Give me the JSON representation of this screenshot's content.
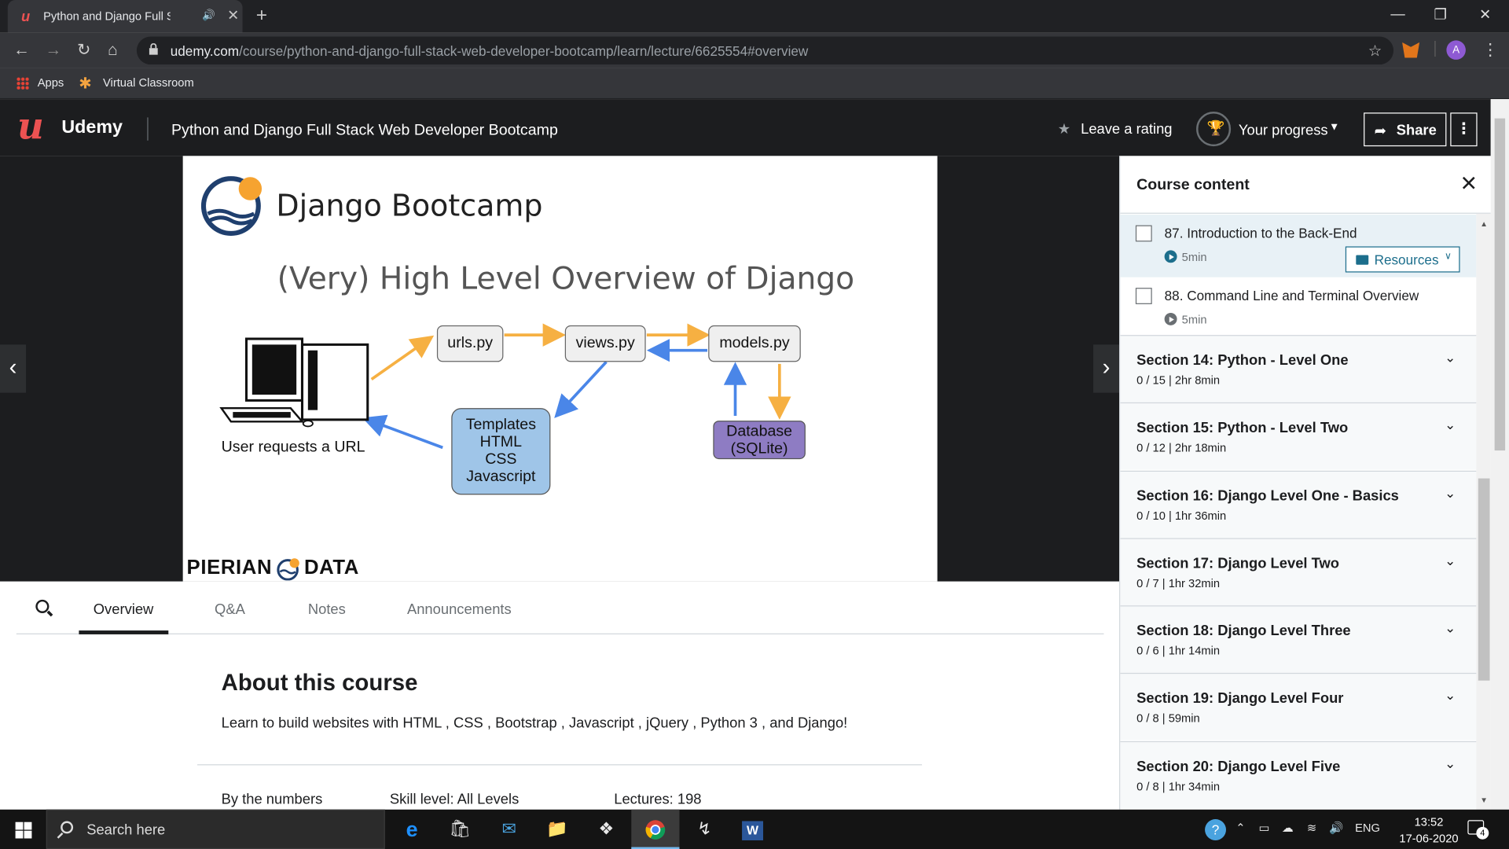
{
  "browser": {
    "tab_title": "Python and Django Full Stack Web Developer Bootcamp",
    "url_domain": "udemy.com",
    "url_path": "/course/python-and-django-full-stack-web-developer-bootcamp/learn/lecture/6625554#overview",
    "bookmarks": [
      "Apps",
      "Virtual Classroom"
    ],
    "profile_initial": "A"
  },
  "header": {
    "logo": "Udemy",
    "course_title": "Python and Django Full Stack Web Developer Bootcamp",
    "rating_label": "Leave a rating",
    "progress_label": "Your progress",
    "share_label": "Share"
  },
  "slide": {
    "brand_title": "Django Bootcamp",
    "heading": "(Very) High Level Overview of Django",
    "user_caption": "User requests a URL",
    "nodes": {
      "urls": "urls.py",
      "views": "views.py",
      "models": "models.py",
      "templates": [
        "Templates",
        "HTML",
        "CSS",
        "Javascript"
      ],
      "database": [
        "Database",
        "(SQLite)"
      ]
    },
    "footer_left": "PIERIAN",
    "footer_right": "DATA"
  },
  "content_tabs": [
    "Overview",
    "Q&A",
    "Notes",
    "Announcements"
  ],
  "about": {
    "title": "About this course",
    "description": "Learn to build websites with HTML , CSS , Bootstrap , Javascript , jQuery , Python 3 , and Django!",
    "stats": [
      "By the numbers",
      "Skill level: All Levels",
      "Lectures: 198"
    ]
  },
  "sidebar": {
    "title": "Course content",
    "lectures": [
      {
        "title": "87. Introduction to the Back-End",
        "duration": "5min",
        "resources": "Resources"
      },
      {
        "title": "88. Command Line and Terminal Overview",
        "duration": "5min"
      }
    ],
    "sections": [
      {
        "title": "Section 14: Python - Level One",
        "meta": "0 / 15 | 2hr 8min"
      },
      {
        "title": "Section 15: Python - Level Two",
        "meta": "0 / 12 | 2hr 18min"
      },
      {
        "title": "Section 16: Django Level One - Basics",
        "meta": "0 / 10 | 1hr 36min"
      },
      {
        "title": "Section 17: Django Level Two",
        "meta": "0 / 7 | 1hr 32min"
      },
      {
        "title": "Section 18: Django Level Three",
        "meta": "0 / 6 | 1hr 14min"
      },
      {
        "title": "Section 19: Django Level Four",
        "meta": "0 / 8 | 59min"
      },
      {
        "title": "Section 20: Django Level Five",
        "meta": "0 / 8 | 1hr 34min"
      }
    ]
  },
  "taskbar": {
    "search_placeholder": "Search here",
    "language": "ENG",
    "time": "13:52",
    "date": "17-06-2020",
    "notifications": "4"
  },
  "colors": {
    "udemy_red": "#ec5252",
    "header_bg": "#1c1d1f",
    "node_blue": "#9fc5e8",
    "node_purple": "#8e7cc3",
    "arrow_orange": "#f6b042",
    "arrow_blue": "#4a86e8"
  }
}
